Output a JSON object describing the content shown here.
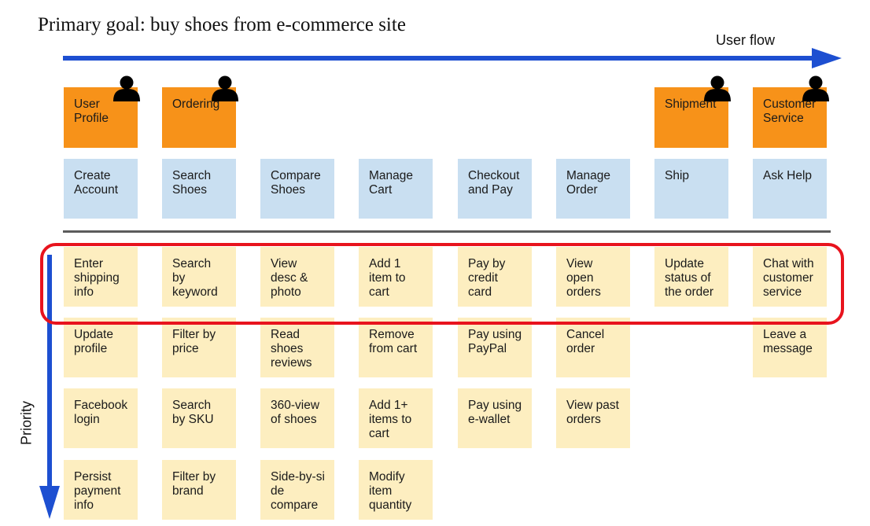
{
  "title": "Primary goal: buy shoes from e-commerce site",
  "user_flow_label": "User flow",
  "priority_label": "Priority",
  "colors": {
    "activity": "#f79219",
    "step": "#c9dff1",
    "task": "#fdeec0",
    "arrow": "#1d4fd1",
    "highlight": "#e8131d"
  },
  "activities": [
    {
      "label": "User\nProfile",
      "column": 0
    },
    {
      "label": "Ordering",
      "column": 1
    },
    {
      "label": "Shipment",
      "column": 6
    },
    {
      "label": "Customer\nService",
      "column": 7
    }
  ],
  "steps": [
    "Create\nAccount",
    "Search\nShoes",
    "Compare\nShoes",
    "Manage\nCart",
    "Checkout\nand Pay",
    "Manage\nOrder",
    "Ship",
    "Ask Help"
  ],
  "tasks": [
    [
      "Enter\nshipping\ninfo",
      "Search\nby\nkeyword",
      "View\ndesc &\nphoto",
      "Add 1\nitem to\ncart",
      "Pay by\ncredit\ncard",
      "View\nopen\norders",
      "Update\nstatus of\nthe order",
      "Chat with\ncustomer\nservice"
    ],
    [
      "Update\nprofile",
      "Filter by\nprice",
      "Read\nshoes\nreviews",
      "Remove\nfrom cart",
      "Pay using\nPayPal",
      "Cancel\norder",
      null,
      "Leave a\nmessage"
    ],
    [
      "Facebook\nlogin",
      "Search\nby SKU",
      "360-view\nof shoes",
      "Add 1+\nitems to\ncart",
      "Pay using\ne-wallet",
      "View past\norders",
      null,
      null
    ],
    [
      "Persist\npayment\ninfo",
      "Filter by\nbrand",
      "Side-by-si\nde\ncompare",
      "Modify\nitem\nquantity",
      null,
      null,
      null,
      null
    ]
  ]
}
